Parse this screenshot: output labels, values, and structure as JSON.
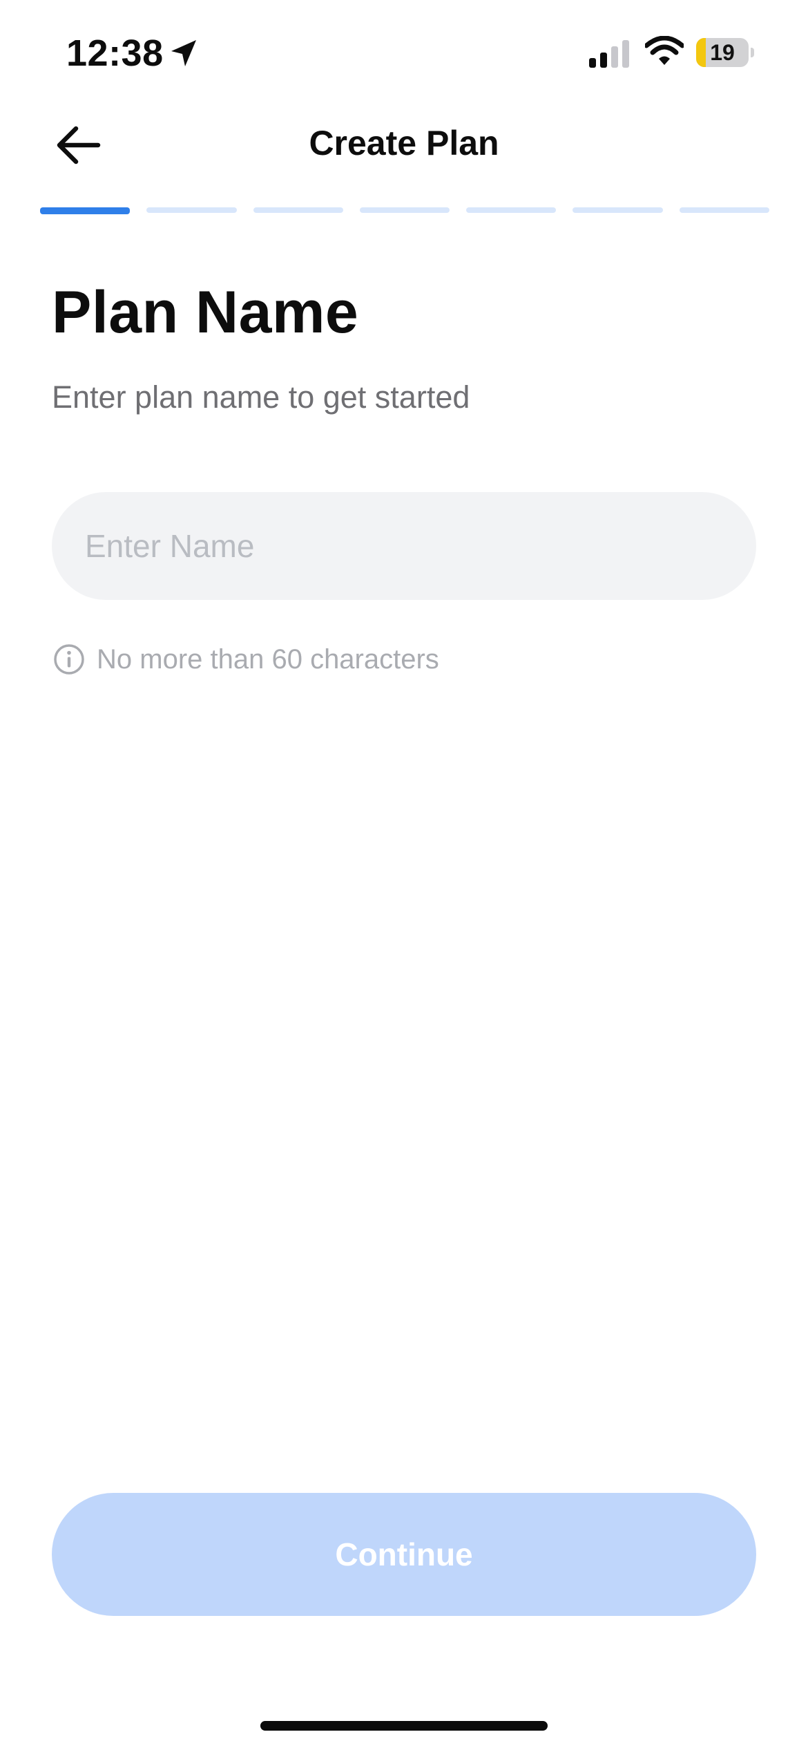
{
  "status_bar": {
    "time": "12:38",
    "battery_level": "19",
    "battery_fraction": 0.19,
    "battery_color": "#f3c70f",
    "icons": [
      "location-arrow-icon",
      "cellular-signal-icon",
      "wifi-icon",
      "battery-icon"
    ]
  },
  "nav": {
    "title": "Create Plan",
    "back_icon": "arrow-left-icon"
  },
  "progress": {
    "total_steps": 7,
    "current_step": 1,
    "active_color": "#2f7fe9",
    "inactive_color": "#d8e6fb"
  },
  "main": {
    "heading": "Plan Name",
    "subtitle": "Enter plan name to get started",
    "name_input": {
      "value": "",
      "placeholder": "Enter Name"
    },
    "hint": {
      "icon": "info-icon",
      "text": "No more than 60 characters"
    }
  },
  "footer": {
    "continue_label": "Continue",
    "continue_color": "#bfd6fb"
  }
}
